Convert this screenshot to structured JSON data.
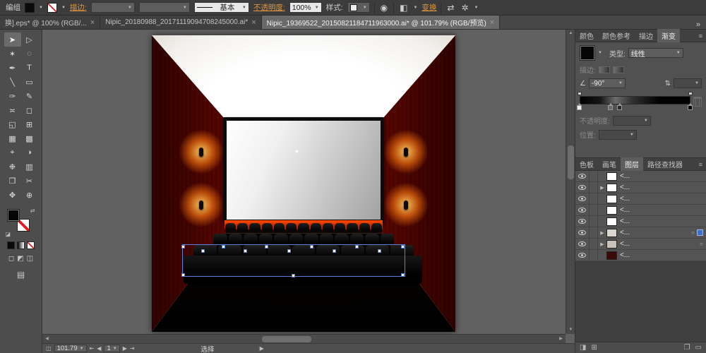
{
  "icons": {
    "dropdown": "▼",
    "overflow": "»",
    "close": "×",
    "panel_menu": "≡",
    "recolor": "◉",
    "align": "◧",
    "doc_setup": "❐",
    "transform_a": "⇄",
    "transform_b": "✲",
    "angle": "∠",
    "reverse": "⇅",
    "screen_mode": "▤",
    "draw_normal": "◻",
    "draw_behind": "◩",
    "draw_inside": "◫",
    "swap": "⇄",
    "default_fs": "◪",
    "status_misc": "◫",
    "nav_first": "⇤",
    "nav_prev": "◀",
    "nav_next": "▶",
    "nav_last": "⇥",
    "scroll_up": "▲",
    "scroll_down": "▼",
    "scroll_left": "◀",
    "scroll_right": "▶",
    "expand": "▶",
    "target": "○",
    "footer_mask": "◨",
    "footer_sublayer": "⊞",
    "footer_new": "❐",
    "footer_trash": "▭"
  },
  "control_bar": {
    "selection_type": "编组",
    "stroke_label": "描边:",
    "brush_name": "基本",
    "opacity_label": "不透明度:",
    "opacity_value": "100%",
    "style_label": "样式:",
    "transform_link": "变换"
  },
  "document_tabs": {
    "items": [
      {
        "title": "换].eps* @ 100% (RGB/...",
        "active": false
      },
      {
        "title": "Nipic_20180988_20171119094708245000.ai*",
        "active": false
      },
      {
        "title": "Nipic_19369522_20150821184711963000.ai* @ 101.79% (RGB/预览)",
        "active": true
      }
    ]
  },
  "tools": [
    {
      "name": "selection",
      "glyph": "➤",
      "active": true
    },
    {
      "name": "direct-selection",
      "glyph": "▷",
      "active": false
    },
    {
      "name": "magic-wand",
      "glyph": "✶",
      "active": false
    },
    {
      "name": "lasso",
      "glyph": "◌",
      "active": false
    },
    {
      "name": "pen",
      "glyph": "✒",
      "active": false
    },
    {
      "name": "type",
      "glyph": "T",
      "active": false
    },
    {
      "name": "line-segment",
      "glyph": "╲",
      "active": false
    },
    {
      "name": "rectangle",
      "glyph": "▭",
      "active": false
    },
    {
      "name": "paintbrush",
      "glyph": "✑",
      "active": false
    },
    {
      "name": "pencil",
      "glyph": "✎",
      "active": false
    },
    {
      "name": "width",
      "glyph": "≍",
      "active": false
    },
    {
      "name": "free-transform",
      "glyph": "◻",
      "active": false
    },
    {
      "name": "shape-builder",
      "glyph": "◱",
      "active": false
    },
    {
      "name": "perspective-grid",
      "glyph": "⊞",
      "active": false
    },
    {
      "name": "mesh",
      "glyph": "▦",
      "active": false
    },
    {
      "name": "gradient",
      "glyph": "▩",
      "active": false
    },
    {
      "name": "eyedropper",
      "glyph": "⌖",
      "active": false
    },
    {
      "name": "blend",
      "glyph": "◑",
      "active": false
    },
    {
      "name": "symbol-sprayer",
      "glyph": "❉",
      "active": false
    },
    {
      "name": "column-graph",
      "glyph": "▥",
      "active": false
    },
    {
      "name": "artboard",
      "glyph": "❐",
      "active": false
    },
    {
      "name": "slice",
      "glyph": "✂",
      "active": false
    },
    {
      "name": "hand",
      "glyph": "✥",
      "active": false
    },
    {
      "name": "zoom",
      "glyph": "⊕",
      "active": false
    }
  ],
  "canvas": {
    "artwork": {
      "description": "cinema interior with red walls, glowing wall lamps, movie screen and black seat rows; front seat group selected",
      "seat_rows": [
        13,
        12,
        9
      ],
      "wall_color": "#b81305",
      "glow_color": "#ff9a2e",
      "strip_color": "#ff4a00",
      "selection_color": "#5b82da"
    }
  },
  "gradient_panel": {
    "tabs": [
      {
        "id": "color",
        "label": "颜色",
        "active": false
      },
      {
        "id": "color-guide",
        "label": "颜色参考",
        "active": false
      },
      {
        "id": "stroke",
        "label": "描边",
        "active": false
      },
      {
        "id": "gradient",
        "label": "渐变",
        "active": true
      }
    ],
    "type_label": "类型:",
    "type_value": "线性",
    "stroke_label": "描边:",
    "angle_value": "-90°",
    "opacity_label": "不透明度:",
    "location_label": "位置:",
    "stops": [
      {
        "pct": 0,
        "color": "#f0f0f0"
      },
      {
        "pct": 28,
        "color": "#6a6a6a"
      },
      {
        "pct": 36,
        "color": "#2a2a2a"
      },
      {
        "pct": 100,
        "color": "#000000"
      }
    ],
    "opacity_stops_pct": [
      0,
      100
    ]
  },
  "layers_panel": {
    "tabs": [
      {
        "id": "swatches",
        "label": "色板",
        "active": false
      },
      {
        "id": "brushes",
        "label": "画笔",
        "active": false
      },
      {
        "id": "layers",
        "label": "图层",
        "active": true
      },
      {
        "id": "pathfinder",
        "label": "路径查找器",
        "active": false
      }
    ],
    "rows": [
      {
        "name": "<...",
        "expand": false,
        "thumb": "#ffffff",
        "target": false,
        "selected": false
      },
      {
        "name": "<...",
        "expand": true,
        "thumb": "#ffffff",
        "target": false,
        "selected": false
      },
      {
        "name": "<...",
        "expand": false,
        "thumb": "#ffffff",
        "target": false,
        "selected": false
      },
      {
        "name": "<...",
        "expand": false,
        "thumb": "#ffffff",
        "target": false,
        "selected": false
      },
      {
        "name": "<...",
        "expand": false,
        "thumb": "#ffffff",
        "target": false,
        "selected": false
      },
      {
        "name": "<...",
        "expand": true,
        "thumb": "#dcd6d0",
        "target": true,
        "selected": true
      },
      {
        "name": "<...",
        "expand": true,
        "thumb": "#c9c2ba",
        "target": true,
        "selected": false
      },
      {
        "name": "<...",
        "expand": false,
        "thumb": "#3a0b06",
        "target": false,
        "selected": false
      }
    ]
  },
  "status_bar": {
    "zoom_value": "101.79",
    "artboard_value": "1",
    "tool_name": "选择"
  }
}
